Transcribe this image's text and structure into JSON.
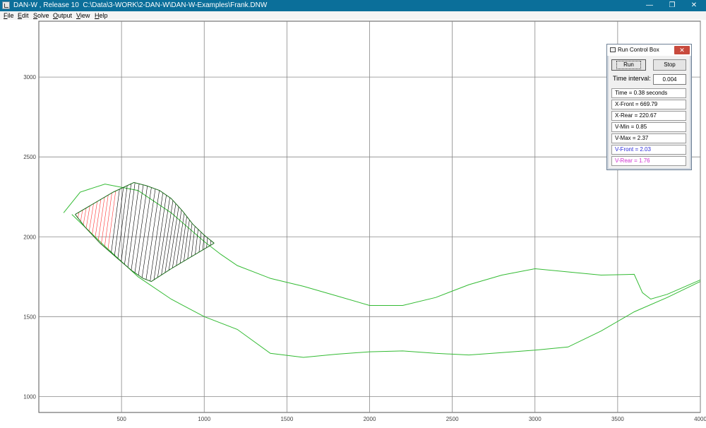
{
  "window": {
    "title": "DAN-W , Release 10  C:\\Data\\3-WORK\\2-DAN-W\\DAN-W-Examples\\Frank.DNW",
    "controls": {
      "minimize": "—",
      "restore": "❐",
      "close": "✕"
    }
  },
  "menu": {
    "items": [
      {
        "label": "File",
        "mnemonic": "F",
        "rest": "ile"
      },
      {
        "label": "Edit",
        "mnemonic": "E",
        "rest": "dit"
      },
      {
        "label": "Solve",
        "mnemonic": "S",
        "rest": "olve"
      },
      {
        "label": "Output",
        "mnemonic": "O",
        "rest": "utput"
      },
      {
        "label": "View",
        "mnemonic": "V",
        "rest": "iew"
      },
      {
        "label": "Help",
        "mnemonic": "H",
        "rest": "elp"
      }
    ]
  },
  "chart_data": {
    "type": "line",
    "title": "",
    "xlabel": "",
    "ylabel": "",
    "xlim": [
      0,
      4000
    ],
    "ylim": [
      900,
      3350
    ],
    "xticks": [
      500,
      1000,
      1500,
      2000,
      2500,
      3000,
      3500,
      4000
    ],
    "yticks": [
      1000,
      1500,
      2000,
      2500,
      3000
    ],
    "xtick_labels": [
      "500",
      "1000",
      "1500",
      "2000",
      "2500",
      "3000",
      "3500",
      "4000"
    ],
    "ytick_labels": [
      "1000",
      "1500",
      "2000",
      "2500",
      "3000"
    ],
    "grid": true,
    "colors": {
      "ground": "#33bb33",
      "mesh": "#000000",
      "rear": "#ff3333",
      "grid": "#888888"
    },
    "series": [
      {
        "role": "ground-surface",
        "x": [
          150,
          250,
          400,
          600,
          800,
          1000,
          1100,
          1200,
          1400,
          1600,
          1800,
          2000,
          2200,
          2400,
          2600,
          2800,
          3000,
          3200,
          3400,
          3600,
          3650,
          3700,
          3800,
          4000
        ],
        "y": [
          2150,
          2280,
          2330,
          2290,
          2150,
          1970,
          1890,
          1820,
          1740,
          1690,
          1630,
          1570,
          1570,
          1620,
          1700,
          1760,
          1800,
          1780,
          1760,
          1765,
          1650,
          1610,
          1640,
          1730
        ]
      },
      {
        "role": "rupture-surface",
        "x": [
          200,
          400,
          600,
          800,
          1000,
          1200,
          1400,
          1600,
          1800,
          2000,
          2200,
          2400,
          2600,
          2800,
          3000,
          3200,
          3400,
          3600,
          3800,
          4000
        ],
        "y": [
          2140,
          1940,
          1750,
          1610,
          1500,
          1420,
          1270,
          1245,
          1265,
          1280,
          1285,
          1270,
          1260,
          1275,
          1290,
          1310,
          1410,
          1530,
          1620,
          1720
        ]
      }
    ],
    "slide_mass": {
      "front_x": 669.79,
      "rear_x": 220.67,
      "top_x": [
        220,
        450,
        575,
        650,
        730,
        800,
        870,
        930,
        1000,
        1060
      ],
      "top_y": [
        2140,
        2280,
        2340,
        2320,
        2290,
        2240,
        2160,
        2080,
        2010,
        1960
      ],
      "base_x": [
        220,
        280,
        370,
        470,
        560,
        630,
        680
      ],
      "base_y": [
        2140,
        2060,
        1960,
        1870,
        1790,
        1740,
        1720
      ],
      "bottom_x": [
        680,
        800,
        1060
      ],
      "bottom_y": [
        1720,
        1800,
        1960
      ],
      "strips": 40,
      "rear_fraction": 0.28
    }
  },
  "run_control": {
    "title": "Run Control Box",
    "close": "✕",
    "run_label": "Run",
    "stop_label": "Stop",
    "interval_label": "Time interval:",
    "interval_value": "0.004",
    "readouts": [
      {
        "text": "Time = 0.38 seconds",
        "color": "#000000"
      },
      {
        "text": "X-Front = 669.79",
        "color": "#000000"
      },
      {
        "text": "X-Rear = 220.67",
        "color": "#000000"
      },
      {
        "text": "V-Min = 0.85",
        "color": "#000000"
      },
      {
        "text": "V-Max = 2.37",
        "color": "#000000"
      },
      {
        "text": "V-Front = 2.03",
        "color": "#2a2ad8"
      },
      {
        "text": "V-Rear = 1.76",
        "color": "#d030d0"
      }
    ]
  }
}
